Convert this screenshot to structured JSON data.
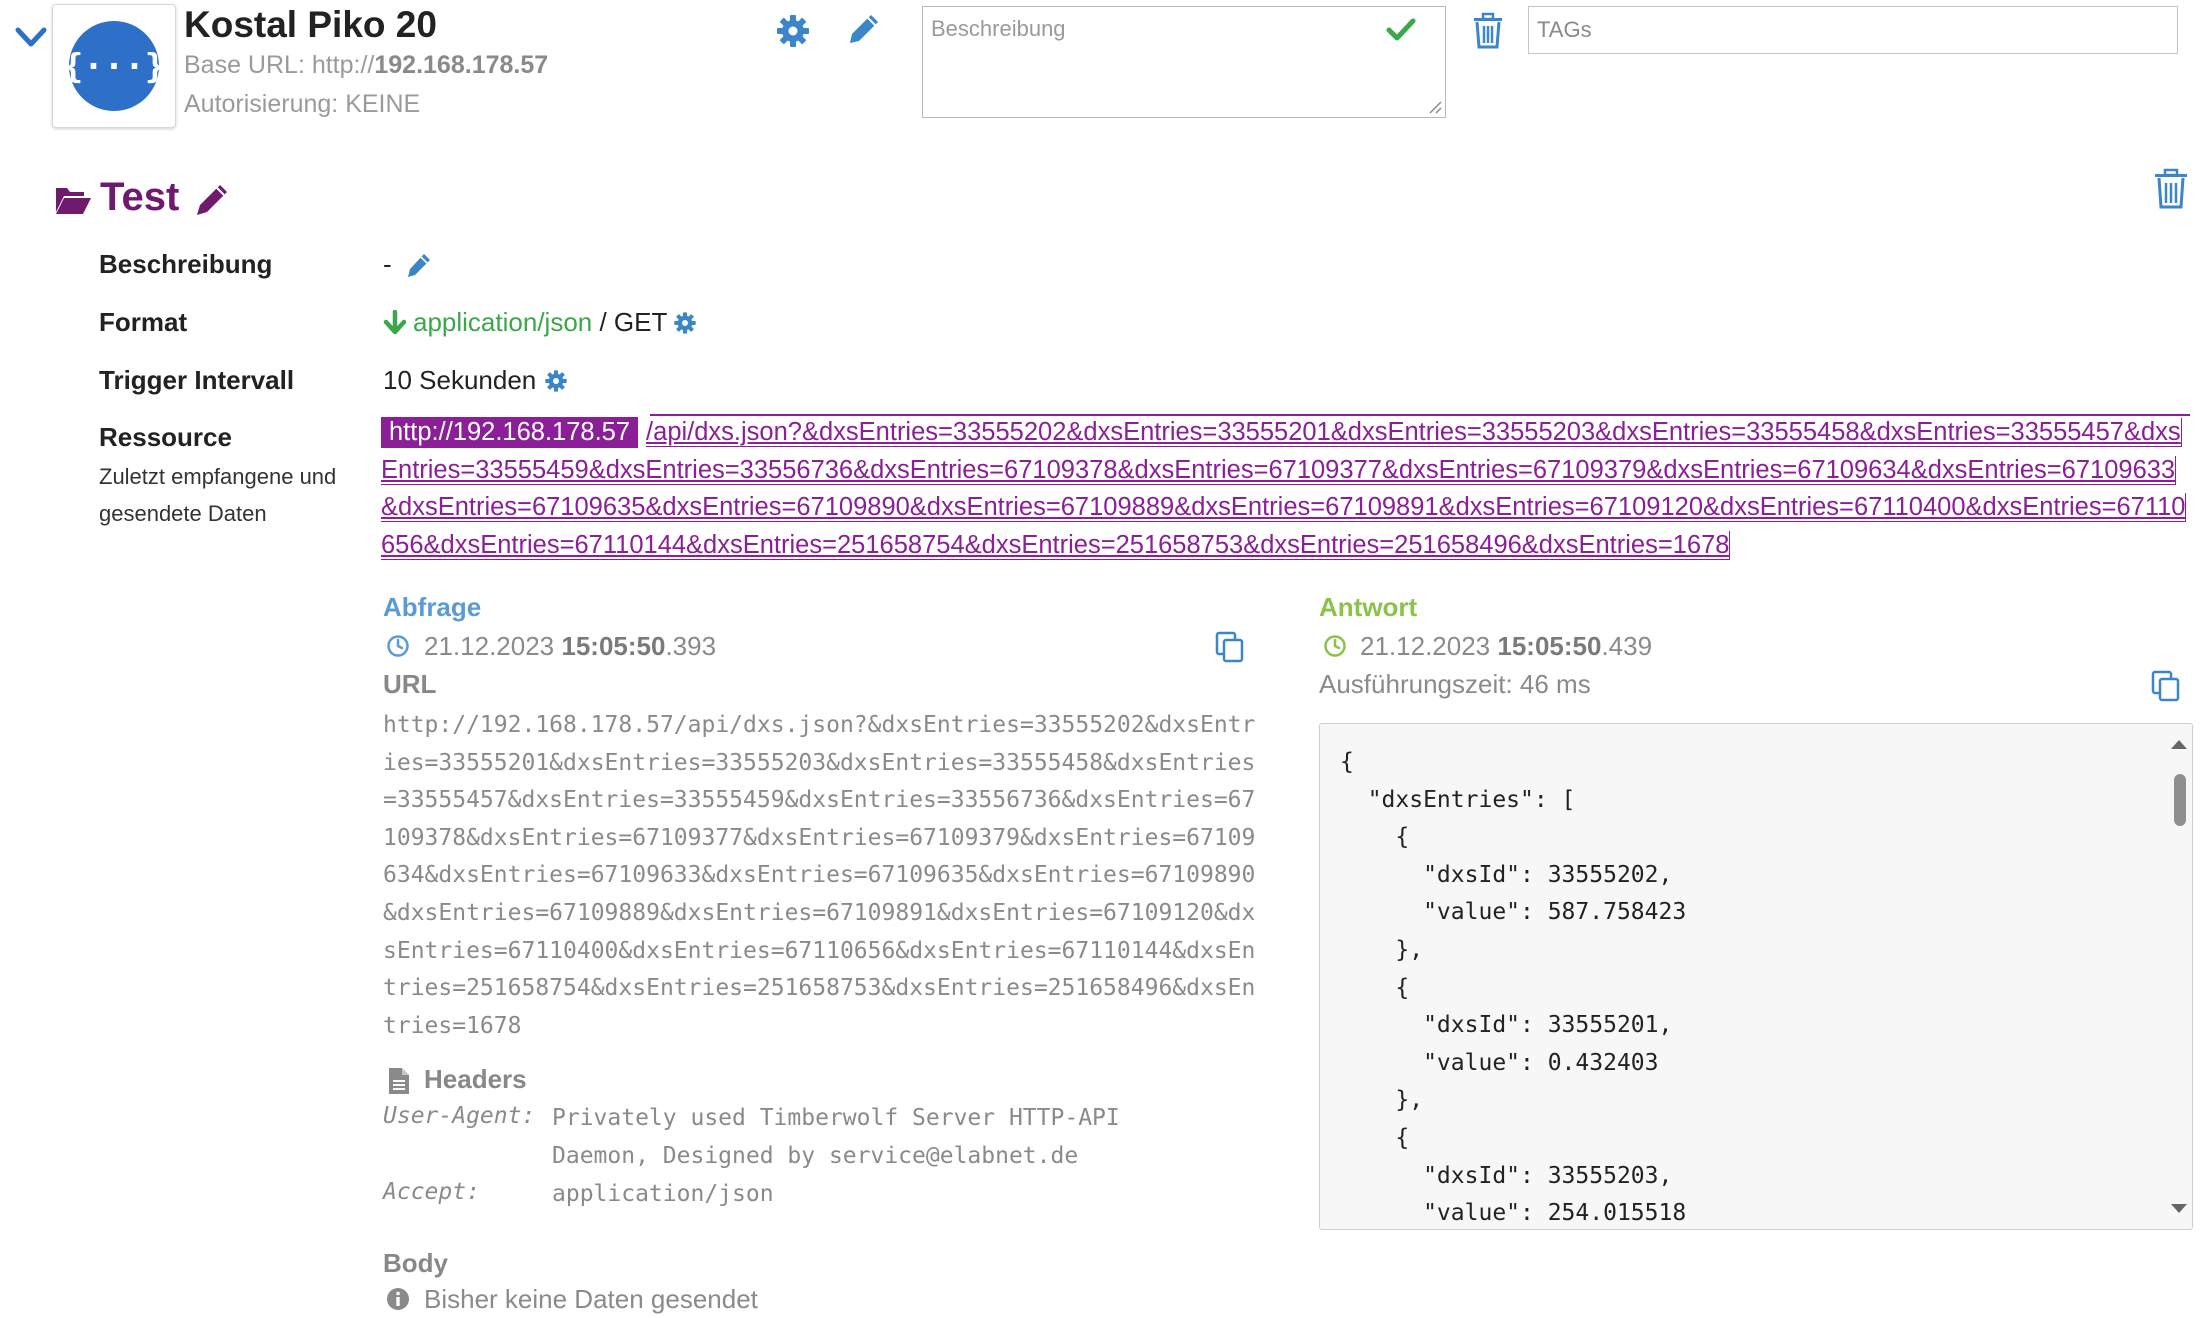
{
  "api": {
    "name": "Kostal Piko 20",
    "base_url_prefix": "Base URL: http://",
    "base_url_host": "192.168.178.57",
    "auth_label": "Autorisierung: KEINE"
  },
  "header": {
    "description_placeholder": "Beschreibung",
    "tags_placeholder": "TAGs"
  },
  "endpoint": {
    "title": "Test",
    "labels": {
      "beschreibung": "Beschreibung",
      "format": "Format",
      "trigger": "Trigger Intervall",
      "ressource": "Ressource",
      "ressource_sub_1": "Zuletzt empfangene und",
      "ressource_sub_2": "gesendete Daten"
    },
    "beschreibung_value": "-",
    "format_mime": "application/json",
    "format_method": " / GET",
    "trigger_value": "10 Sekunden",
    "resource_host": "http://192.168.178.57",
    "resource_path": "/api/dxs.json?&dxsEntries=33555202&dxsEntries=33555201&dxsEntries=33555203&dxsEntries=33555458&dxsEntries=33555457&dxsEntries=33555459&dxsEntries=33556736&dxsEntries=67109378&dxsEntries=67109377&dxsEntries=67109379&dxsEntries=67109634&dxsEntries=67109633&dxsEntries=67109635&dxsEntries=67109890&dxsEntries=67109889&dxsEntries=67109891&dxsEntries=67109120&dxsEntries=67110400&dxsEntries=67110656&dxsEntries=67110144&dxsEntries=251658754&dxsEntries=251658753&dxsEntries=251658496&dxsEntries=1678"
  },
  "request": {
    "heading": "Abfrage",
    "date": "21.12.2023 ",
    "time": "15:05:50",
    "ms": ".393",
    "url_heading": "URL",
    "url": "http://192.168.178.57/api/dxs.json?&dxsEntries=33555202&dxsEntries=33555201&dxsEntries=33555203&dxsEntries=33555458&dxsEntries=33555457&dxsEntries=33555459&dxsEntries=33556736&dxsEntries=67109378&dxsEntries=67109377&dxsEntries=67109379&dxsEntries=67109634&dxsEntries=67109633&dxsEntries=67109635&dxsEntries=67109890&dxsEntries=67109889&dxsEntries=67109891&dxsEntries=67109120&dxsEntries=67110400&dxsEntries=67110656&dxsEntries=67110144&dxsEntries=251658754&dxsEntries=251658753&dxsEntries=251658496&dxsEntries=1678",
    "headers_heading": "Headers",
    "headers": [
      {
        "key": "User-Agent:",
        "value": "Privately used Timberwolf Server HTTP-API Daemon, Designed by service@elabnet.de"
      },
      {
        "key": "Accept:",
        "value": "application/json"
      }
    ],
    "body_heading": "Body",
    "body_empty": "Bisher keine Daten gesendet"
  },
  "response": {
    "heading": "Antwort",
    "date": "21.12.2023 ",
    "time": "15:05:50",
    "ms": ".439",
    "duration": "Ausführungszeit: 46 ms",
    "json_text": "{\n  \"dxsEntries\": [\n    {\n      \"dxsId\": 33555202,\n      \"value\": 587.758423\n    },\n    {\n      \"dxsId\": 33555201,\n      \"value\": 0.432403\n    },\n    {\n      \"dxsId\": 33555203,\n      \"value\": 254.015518\n    },"
  },
  "colors": {
    "brand_blue": "#2e6fc7",
    "endpoint_purple": "#6e1b6e",
    "resource_purple": "#8b1f97",
    "request_blue": "#5b9bd5",
    "response_green": "#8bc34a",
    "icon_blue": "#3a86c8",
    "check_green": "#3aa848"
  },
  "icons": {
    "collapse": "chevron-down-icon",
    "logo": "curly-braces-icon",
    "settings": "gear-icon",
    "edit": "pencil-icon",
    "confirm": "check-icon",
    "delete": "trash-icon",
    "folder": "folder-open-icon",
    "format": "arrow-down-icon",
    "time": "clock-icon",
    "copy": "copy-icon",
    "headers": "file-icon",
    "info": "info-icon"
  }
}
